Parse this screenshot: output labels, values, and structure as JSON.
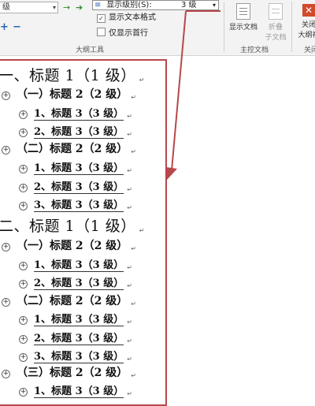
{
  "ribbon": {
    "level_combo": {
      "value": "级",
      "arrow": "▾"
    },
    "promote_arrow": "→",
    "demote_arrow": "➔",
    "expand_icon": "+",
    "collapse_icon": "−",
    "show_level": {
      "label": "显示级别(S):",
      "value": "3 级",
      "arrow": "▾"
    },
    "show_text_format": {
      "label": "显示文本格式",
      "checked": true,
      "mark": "✓"
    },
    "show_first_line": {
      "label": "仅显示首行",
      "checked": false
    },
    "outline_tools_label": "大纲工具",
    "show_document": "显示文档",
    "collapse_subdocs": [
      "折叠",
      "子文档"
    ],
    "master_doc_label": "主控文档",
    "close_btn": [
      "关闭",
      "大纲视"
    ],
    "close_group_label": "关闭"
  },
  "doc": {
    "return_mark": "↵",
    "expand_mark": "+",
    "lines": [
      {
        "text": "一、标题 1（1 级）",
        "level": 1
      },
      {
        "text": "（一）标题 2（2 级）",
        "level": 2
      },
      {
        "text": "1、标题 3（3 级）",
        "level": 3
      },
      {
        "text": "2、标题 3（3 级）",
        "level": 3
      },
      {
        "text": "（二）标题 2（2 级）",
        "level": 2
      },
      {
        "text": "1、标题 3（3 级）",
        "level": 3
      },
      {
        "text": "2、标题 3（3 级）",
        "level": 3
      },
      {
        "text": "3、标题 3（3 级）",
        "level": 3
      },
      {
        "text": "二、标题 1（1 级）",
        "level": 1
      },
      {
        "text": "（一）标题 2（2 级）",
        "level": 2
      },
      {
        "text": "1、标题 3（3 级）",
        "level": 3
      },
      {
        "text": "2、标题 3（3 级）",
        "level": 3
      },
      {
        "text": "（二）标题 2（2 级）",
        "level": 2
      },
      {
        "text": "1、标题 3（3 级）",
        "level": 3
      },
      {
        "text": "2、标题 3（3 级）",
        "level": 3
      },
      {
        "text": "3、标题 3（3 级）",
        "level": 3
      },
      {
        "text": "（三）标题 2（2 级）",
        "level": 2
      },
      {
        "text": "1、标题 3（3 级）",
        "level": 3
      }
    ]
  },
  "colors": {
    "annotation": "#b8474a",
    "ribbon_bg": "#f3f3f3"
  }
}
